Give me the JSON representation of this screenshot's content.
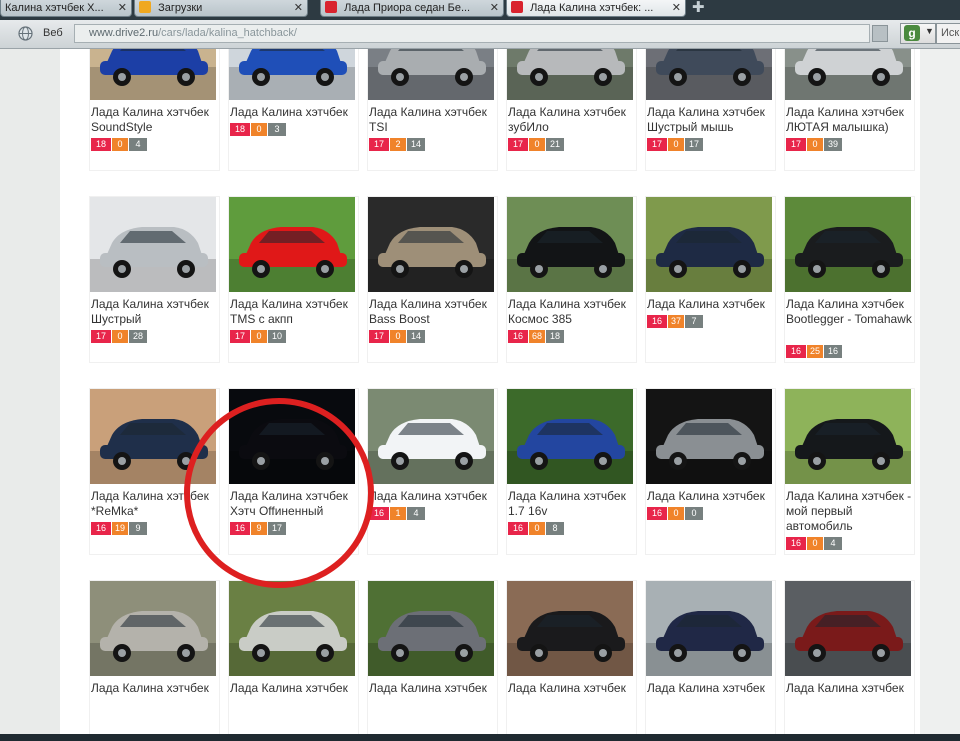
{
  "browser": {
    "tabs": [
      {
        "label": "Калина хэтчбек Х...",
        "fav_color": "#9aa5ab"
      },
      {
        "label": "Загрузки",
        "fav_color": "#f0a820"
      },
      {
        "label": "Лада Приора седан Бе...",
        "fav_color": "#d9232e"
      },
      {
        "label": "Лада Калина хэтчбек: ...",
        "fav_color": "#d9232e"
      }
    ],
    "engine": "Веб",
    "url_host": "www.drive2.ru",
    "url_path": "/cars/lada/kalina_hatchback/",
    "search_placeholder": "Иск"
  },
  "colors": {
    "likes": "#e8254a",
    "comments": "#f0832a",
    "photos": "#77807f",
    "highlight_circle": "#dd2020"
  },
  "cars": [
    {
      "title": "Лада Калина хэтчбек SoundStyle",
      "stats": [
        "18",
        "0",
        "4"
      ],
      "car_color": "#1c3fa6",
      "bg": "#c9b38f"
    },
    {
      "title": "Лада Калина хэтчбек",
      "stats": [
        "18",
        "0",
        "3"
      ],
      "car_color": "#1f4fb8",
      "bg": "#cfd6dc"
    },
    {
      "title": "Лада Калина хэтчбек TSI",
      "stats": [
        "17",
        "2",
        "14"
      ],
      "car_color": "#a9adb0",
      "bg": "#7a7f85"
    },
    {
      "title": "Лада Калина хэтчбек зубИло",
      "stats": [
        "17",
        "0",
        "21"
      ],
      "car_color": "#b7b9bb",
      "bg": "#6e7a6a"
    },
    {
      "title": "Лада Калина хэтчбек Шустрый мышь",
      "stats": [
        "17",
        "0",
        "17"
      ],
      "car_color": "#3f4a5a",
      "bg": "#6d6f76"
    },
    {
      "title": "Лада Калина хэтчбек ЛЮТАЯ малышка)",
      "stats": [
        "17",
        "0",
        "39"
      ],
      "car_color": "#cfd2d4",
      "bg": "#88908a"
    },
    {
      "title": "Лада Калина хэтчбек Шустрый",
      "stats": [
        "17",
        "0",
        "28"
      ],
      "car_color": "#b9bec2",
      "bg": "#e4e6e8"
    },
    {
      "title": "Лада Калина хэтчбек TMS с акпп",
      "stats": [
        "17",
        "0",
        "10"
      ],
      "car_color": "#e01818",
      "bg": "#5f9c3d"
    },
    {
      "title": "Лада Калина хэтчбек Bass Boost",
      "stats": [
        "17",
        "0",
        "14"
      ],
      "car_color": "#9e8f78",
      "bg": "#2a2a2a"
    },
    {
      "title": "Лада Калина хэтчбек Космос 385",
      "stats": [
        "16",
        "68",
        "18"
      ],
      "car_color": "#121416",
      "bg": "#6e8e55"
    },
    {
      "title": "Лада Калина хэтчбек",
      "stats": [
        "16",
        "37",
        "7"
      ],
      "car_color": "#1e2a44",
      "bg": "#7f9a4c"
    },
    {
      "title": "Лада Калина хэтчбек Bootlegger - Tomahawk",
      "stats": [
        "16",
        "25",
        "16"
      ],
      "car_color": "#1a1c1e",
      "bg": "#5d8a3a"
    },
    {
      "title": "Лада Калина хэтчбек *ReMka*",
      "stats": [
        "16",
        "19",
        "9"
      ],
      "car_color": "#1f2f4a",
      "bg": "#c9a07a"
    },
    {
      "title": "Лада Калина хэтчбек Хэтч Offиненный",
      "stats": [
        "16",
        "9",
        "17"
      ],
      "car_color": "#0b0b10",
      "bg": "#080a0e"
    },
    {
      "title": "Лада Калина хэтчбек",
      "stats": [
        "16",
        "1",
        "4"
      ],
      "car_color": "#f2f4f6",
      "bg": "#7b8a72"
    },
    {
      "title": "Лада Калина хэтчбек 1.7 16v",
      "stats": [
        "16",
        "0",
        "8"
      ],
      "car_color": "#2346a0",
      "bg": "#3c6a2a"
    },
    {
      "title": "Лада Калина хэтчбек",
      "stats": [
        "16",
        "0",
        "0"
      ],
      "car_color": "#8a8f93",
      "bg": "#141414"
    },
    {
      "title": "Лада Калина хэтчбек - мой первый автомобиль",
      "stats": [
        "16",
        "0",
        "4"
      ],
      "car_color": "#15181b",
      "bg": "#8eb35a"
    },
    {
      "title": "Лада Калина хэтчбек",
      "stats": [],
      "car_color": "#b4b2ab",
      "bg": "#8e8f7a"
    },
    {
      "title": "Лада Калина хэтчбек",
      "stats": [],
      "car_color": "#c9ccc6",
      "bg": "#6a8044"
    },
    {
      "title": "Лада Калина хэтчбек",
      "stats": [],
      "car_color": "#6c6f76",
      "bg": "#4f7034"
    },
    {
      "title": "Лада Калина хэтчбек",
      "stats": [],
      "car_color": "#1a1a1c",
      "bg": "#8a6b55"
    },
    {
      "title": "Лада Калина хэтчбек",
      "stats": [],
      "car_color": "#202846",
      "bg": "#a8b0b4"
    },
    {
      "title": "Лада Калина хэтчбек",
      "stats": [],
      "car_color": "#7a1a1a",
      "bg": "#5a5e62"
    }
  ]
}
